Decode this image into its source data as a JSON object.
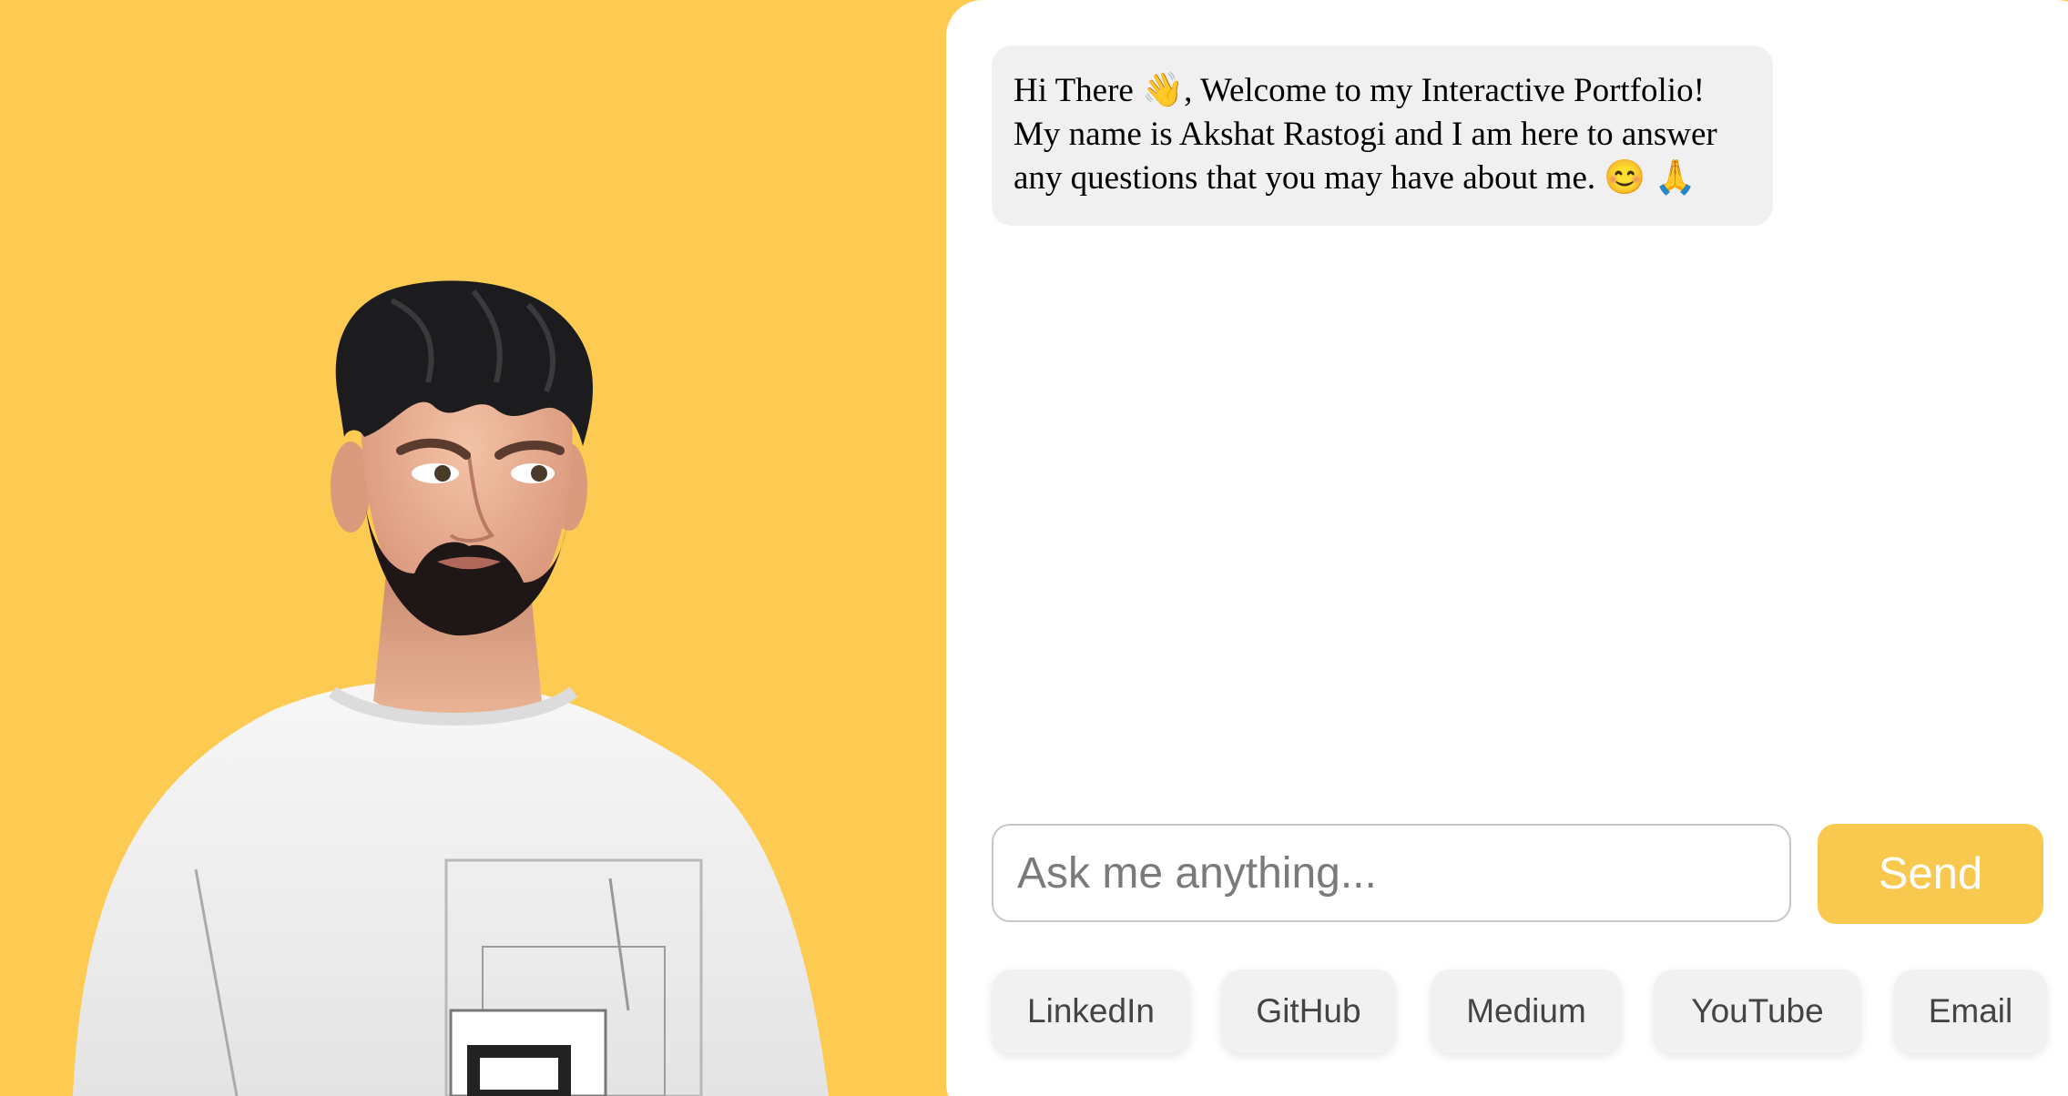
{
  "chat": {
    "welcome_message": "Hi There 👋, Welcome to my Interactive Portfolio! My name is Akshat Rastogi and I am here to answer any questions that you may have about me. 😊 🙏"
  },
  "input": {
    "placeholder": "Ask me anything...",
    "value": ""
  },
  "send_label": "Send",
  "links": [
    {
      "label": "LinkedIn"
    },
    {
      "label": "GitHub"
    },
    {
      "label": "Medium"
    },
    {
      "label": "YouTube"
    },
    {
      "label": "Email"
    }
  ],
  "colors": {
    "background": "#FDCB52",
    "accent": "#F9C84E",
    "panel": "#FFFFFF",
    "bubble": "#F0F0F0"
  }
}
